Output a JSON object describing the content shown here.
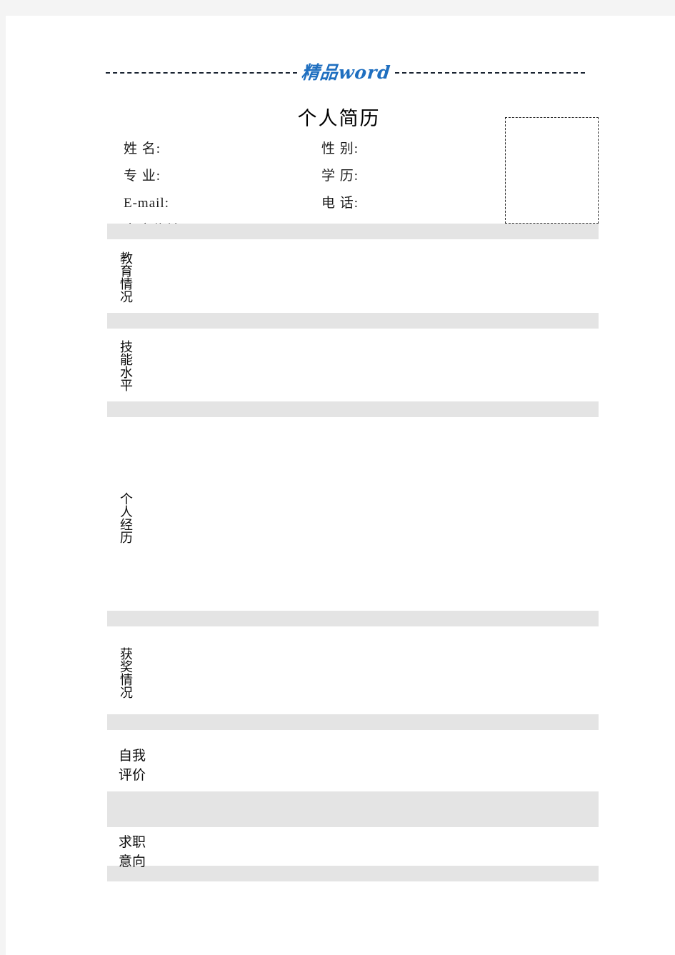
{
  "header": {
    "watermark": "精品word",
    "dash_color": "#1a2432",
    "watermark_color": "#1f6fc0"
  },
  "document": {
    "title": "个人简历",
    "page_background": "#ffffff",
    "margin_background": "#f4f4f4",
    "bar_color": "#e4e4e4"
  },
  "identity": {
    "fields": [
      {
        "label": "姓  名:",
        "value": ""
      },
      {
        "label": "性  别:",
        "value": ""
      },
      {
        "label": "专  业:",
        "value": ""
      },
      {
        "label": "学  历:",
        "value": ""
      },
      {
        "label": "E-mail:",
        "value": ""
      },
      {
        "label": "电  话:",
        "value": ""
      },
      {
        "label": "家庭住址:",
        "value": ""
      }
    ],
    "photo_box_label": ""
  },
  "sections": [
    {
      "label": "教育情况",
      "chars": [
        "教",
        "育",
        "情",
        "况"
      ],
      "orientation": "vertical",
      "content": ""
    },
    {
      "label": "技能水平",
      "chars": [
        "技",
        "能",
        "水",
        "平"
      ],
      "orientation": "vertical",
      "content": ""
    },
    {
      "label": "个人经历",
      "chars": [
        "个",
        "人",
        "经",
        "历"
      ],
      "orientation": "vertical",
      "content": ""
    },
    {
      "label": "获奖情况",
      "chars": [
        "获",
        "奖",
        "情",
        "况"
      ],
      "orientation": "vertical",
      "content": ""
    },
    {
      "label": "自我评价",
      "lines": [
        "自我",
        "评价"
      ],
      "orientation": "stacked-pairs",
      "content": ""
    },
    {
      "label": "求职意向",
      "lines": [
        "求职",
        "意向"
      ],
      "orientation": "stacked-pairs",
      "content": ""
    }
  ]
}
